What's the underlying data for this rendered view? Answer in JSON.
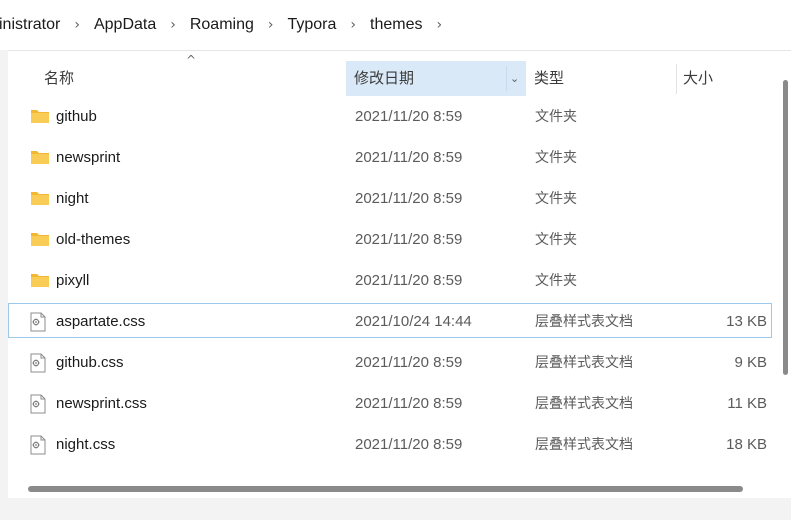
{
  "breadcrumb": [
    "inistrator",
    "AppData",
    "Roaming",
    "Typora",
    "themes"
  ],
  "columns": {
    "name": "名称",
    "date": "修改日期",
    "type": "类型",
    "size": "大小"
  },
  "files": [
    {
      "name": "github",
      "date": "2021/11/20 8:59",
      "type": "文件夹",
      "size": "",
      "icon": "folder-icon"
    },
    {
      "name": "newsprint",
      "date": "2021/11/20 8:59",
      "type": "文件夹",
      "size": "",
      "icon": "folder-icon"
    },
    {
      "name": "night",
      "date": "2021/11/20 8:59",
      "type": "文件夹",
      "size": "",
      "icon": "folder-icon"
    },
    {
      "name": "old-themes",
      "date": "2021/11/20 8:59",
      "type": "文件夹",
      "size": "",
      "icon": "folder-icon"
    },
    {
      "name": "pixyll",
      "date": "2021/11/20 8:59",
      "type": "文件夹",
      "size": "",
      "icon": "folder-icon"
    },
    {
      "name": "aspartate.css",
      "date": "2021/10/24 14:44",
      "type": "层叠样式表文档",
      "size": "13 KB",
      "icon": "css-file-icon",
      "selected": true
    },
    {
      "name": "github.css",
      "date": "2021/11/20 8:59",
      "type": "层叠样式表文档",
      "size": "9 KB",
      "icon": "css-file-icon"
    },
    {
      "name": "newsprint.css",
      "date": "2021/11/20 8:59",
      "type": "层叠样式表文档",
      "size": "11 KB",
      "icon": "css-file-icon"
    },
    {
      "name": "night.css",
      "date": "2021/11/20 8:59",
      "type": "层叠样式表文档",
      "size": "18 KB",
      "icon": "css-file-icon"
    }
  ],
  "colors": {
    "accent_header": "#d9e9f7",
    "selection_border": "#99c9ec",
    "folder": "#f7c54a"
  }
}
